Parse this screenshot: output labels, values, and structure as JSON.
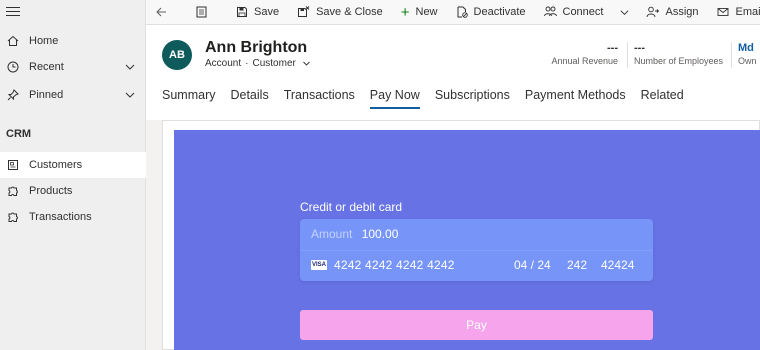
{
  "sidebar": {
    "items": [
      {
        "label": "Home",
        "icon": "home-icon"
      },
      {
        "label": "Recent",
        "icon": "clock-icon"
      },
      {
        "label": "Pinned",
        "icon": "pin-icon"
      }
    ],
    "section": "CRM",
    "crm_items": [
      {
        "label": "Customers",
        "icon": "customers-icon"
      },
      {
        "label": "Products",
        "icon": "puzzle-icon"
      },
      {
        "label": "Transactions",
        "icon": "puzzle-icon"
      }
    ]
  },
  "toolbar": {
    "save": "Save",
    "save_close": "Save & Close",
    "new": "New",
    "deactivate": "Deactivate",
    "connect": "Connect",
    "assign": "Assign",
    "email_link": "Email a Link"
  },
  "record": {
    "initials": "AB",
    "name": "Ann Brighton",
    "entity": "Account",
    "form": "Customer",
    "kpis": [
      {
        "value": "---",
        "label": "Annual Revenue"
      },
      {
        "value": "---",
        "label": "Number of Employees"
      },
      {
        "value": "Md",
        "label": "Own"
      }
    ]
  },
  "tabs": [
    "Summary",
    "Details",
    "Transactions",
    "Pay Now",
    "Subscriptions",
    "Payment Methods",
    "Related"
  ],
  "active_tab": "Pay Now",
  "payment": {
    "label": "Credit or debit card",
    "amount_label": "Amount",
    "amount_value": "100.00",
    "card_brand": "VISA",
    "card_number": "4242 4242 4242 4242",
    "expiry": "04 / 24",
    "cvc": "242",
    "zip": "42424",
    "pay_button": "Pay"
  },
  "colors": {
    "accent": "#115ea3",
    "avatar": "#0f5b5b",
    "panel": "#6772e5",
    "card_field": "#7795f8",
    "pay_button": "#f6a4eb"
  }
}
